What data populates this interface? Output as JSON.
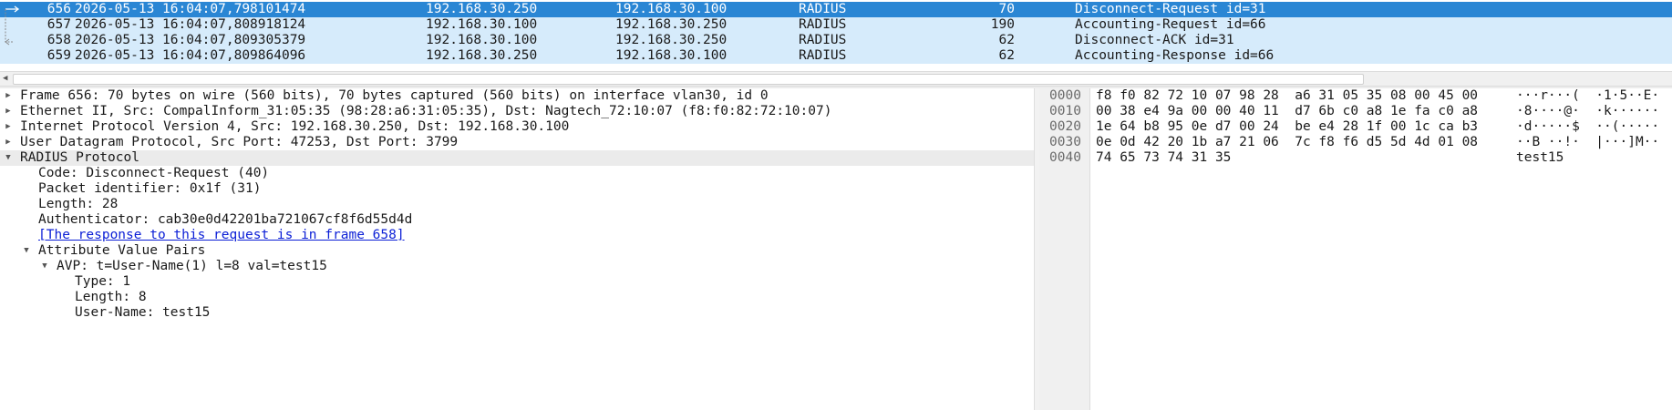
{
  "packets": [
    {
      "no": "656",
      "time": "2026-05-13 16:04:07,798101474",
      "src": "192.168.30.250",
      "dst": "192.168.30.100",
      "proto": "RADIUS",
      "len": "70",
      "info": "Disconnect-Request id=31"
    },
    {
      "no": "657",
      "time": "2026-05-13 16:04:07,808918124",
      "src": "192.168.30.100",
      "dst": "192.168.30.250",
      "proto": "RADIUS",
      "len": "190",
      "info": "Accounting-Request id=66"
    },
    {
      "no": "658",
      "time": "2026-05-13 16:04:07,809305379",
      "src": "192.168.30.100",
      "dst": "192.168.30.250",
      "proto": "RADIUS",
      "len": "62",
      "info": "Disconnect-ACK id=31"
    },
    {
      "no": "659",
      "time": "2026-05-13 16:04:07,809864096",
      "src": "192.168.30.250",
      "dst": "192.168.30.100",
      "proto": "RADIUS",
      "len": "62",
      "info": "Accounting-Response id=66"
    }
  ],
  "selected_packet": "656",
  "detail": {
    "frame": "Frame 656: 70 bytes on wire (560 bits), 70 bytes captured (560 bits) on interface vlan30, id 0",
    "ethernet": "Ethernet II, Src: CompalInform_31:05:35 (98:28:a6:31:05:35), Dst: Nagtech_72:10:07 (f8:f0:82:72:10:07)",
    "ip": "Internet Protocol Version 4, Src: 192.168.30.250, Dst: 192.168.30.100",
    "udp": "User Datagram Protocol, Src Port: 47253, Dst Port: 3799",
    "radius": "RADIUS Protocol",
    "code": "Code: Disconnect-Request (40)",
    "packet_id": "Packet identifier: 0x1f (31)",
    "length": "Length: 28",
    "authenticator": "Authenticator: cab30e0d42201ba721067cf8f6d55d4d",
    "response_link": "[The response to this request is in frame 658]",
    "avp_group": "Attribute Value Pairs",
    "avp": "AVP: t=User-Name(1) l=8 val=test15",
    "avp_type": "Type: 1",
    "avp_length": "Length: 8",
    "avp_username": "User-Name: test15"
  },
  "bytes": [
    {
      "offset": "0000",
      "hex": "f8 f0 82 72 10 07 98 28  a6 31 05 35 08 00 45 00",
      "ascii": "···r···(  ·1·5··E·"
    },
    {
      "offset": "0010",
      "hex": "00 38 e4 9a 00 00 40 11  d7 6b c0 a8 1e fa c0 a8",
      "ascii": "·8····@·  ·k······"
    },
    {
      "offset": "0020",
      "hex": "1e 64 b8 95 0e d7 00 24  be e4 28 1f 00 1c ca b3",
      "ascii": "·d·····$  ··(·····"
    },
    {
      "offset": "0030",
      "hex": "0e 0d 42 20 1b a7 21 06  7c f8 f6 d5 5d 4d 01 08",
      "ascii": "··B ··!·  |···]M··"
    },
    {
      "offset": "0040",
      "hex": "74 65 73 74 31 35",
      "ascii": "test15"
    }
  ],
  "colors": {
    "selected_row": "#2a86d4",
    "row": "#d6ebfb",
    "link": "#0a1ed6"
  }
}
